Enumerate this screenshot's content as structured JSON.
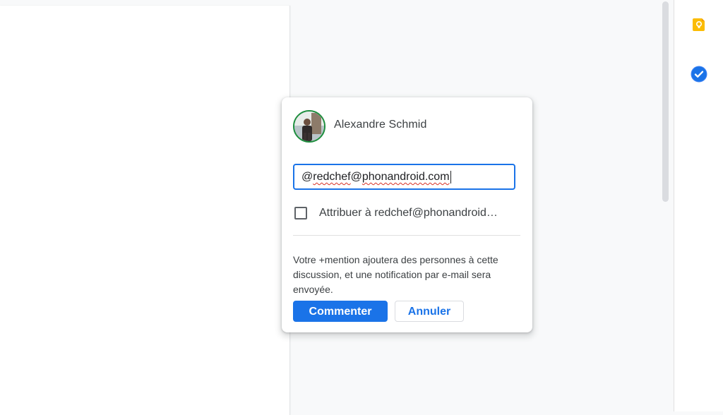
{
  "comment_box": {
    "author_name": "Alexandre Schmid",
    "input_prefix": "@",
    "input_misspelled_1": "redchef",
    "input_at": "@",
    "input_misspelled_2": "phonandroid.com",
    "assign_label": "Attribuer à redchef@phonandroid…",
    "assign_checked": false,
    "hint_text": "Votre +mention ajoutera des personnes à cette discussion, et une notification par e-mail sera envoyée.",
    "comment_button": "Commenter",
    "cancel_button": "Annuler"
  },
  "side_panel": {
    "icons": [
      "keep-icon",
      "tasks-icon"
    ]
  },
  "colors": {
    "accent": "#1a73e8",
    "keep": "#fbbc04",
    "avatar_ring": "#1e8e3e",
    "spell_error": "#d93025"
  }
}
